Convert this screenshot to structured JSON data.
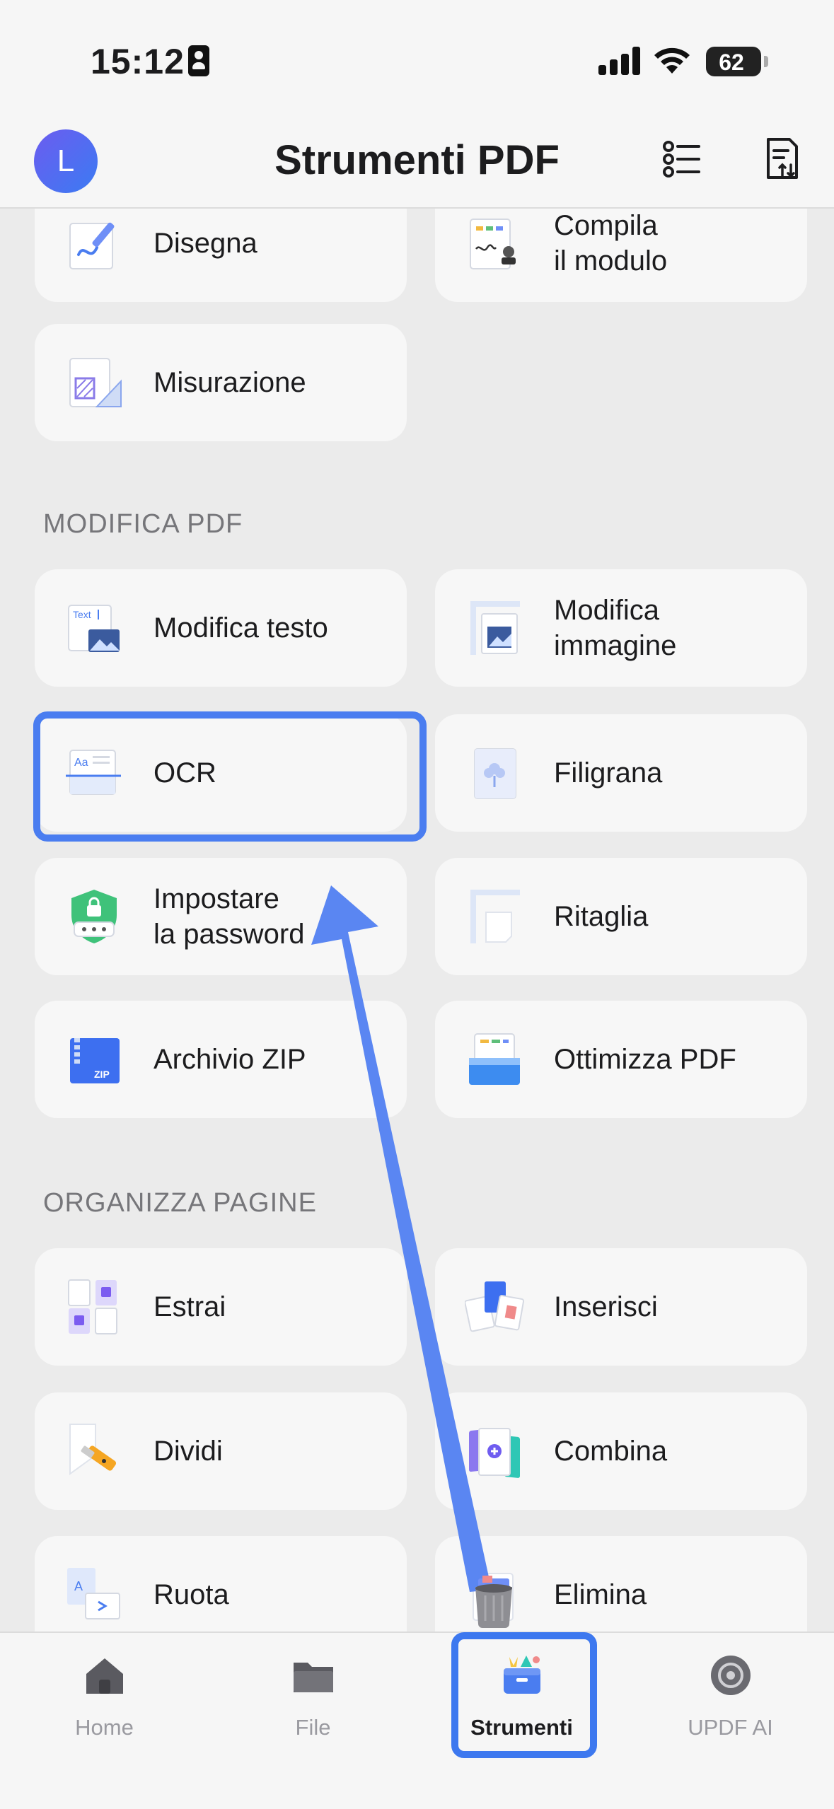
{
  "status_bar": {
    "time": "15:12",
    "battery": "62"
  },
  "header": {
    "avatar_letter": "L",
    "title": "Strumenti PDF"
  },
  "sections": [
    {
      "title": "MODIFICA PDF"
    },
    {
      "title": "ORGANIZZA PAGINE"
    }
  ],
  "tools": {
    "disegna": "Disegna",
    "compila": "Compila\nil modulo",
    "misurazione": "Misurazione",
    "modifica_testo": "Modifica testo",
    "modifica_immagine": "Modifica\nimmagine",
    "ocr": "OCR",
    "filigrana": "Filigrana",
    "password": "Impostare\nla password",
    "ritaglia": "Ritaglia",
    "zip": "Archivio ZIP",
    "ottimizza": "Ottimizza PDF",
    "estrai": "Estrai",
    "inserisci": "Inserisci",
    "dividi": "Dividi",
    "combina": "Combina",
    "ruota": "Ruota",
    "elimina": "Elimina"
  },
  "icon_snippets": {
    "text": "Text",
    "aa": "Aa",
    "zip": "ZIP",
    "rotate_a": "A"
  },
  "tab_bar": {
    "home": "Home",
    "file": "File",
    "strumenti": "Strumenti",
    "updf_ai": "UPDF AI"
  },
  "accent_color": "#4a7df0"
}
